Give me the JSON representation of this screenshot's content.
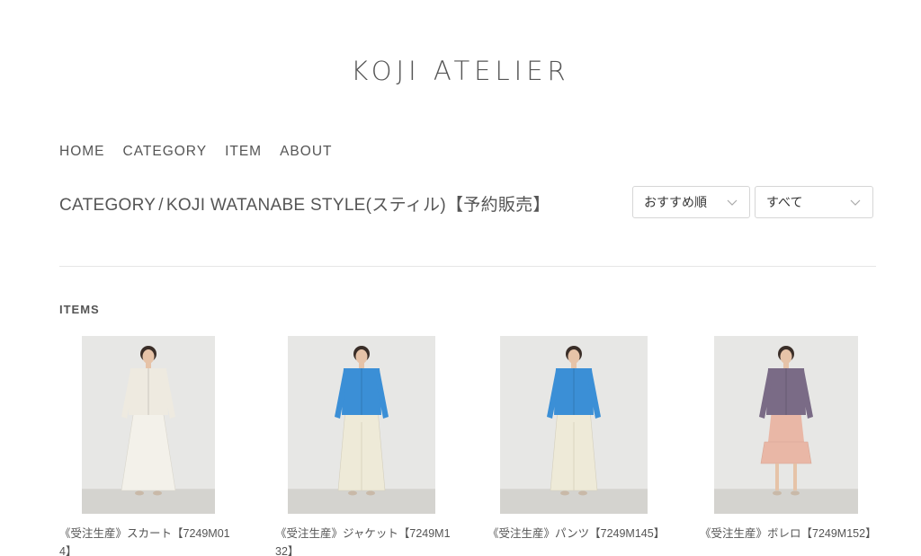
{
  "site": {
    "logo": "KOJI ATELIER"
  },
  "nav": {
    "items": [
      {
        "label": "HOME"
      },
      {
        "label": "CATEGORY"
      },
      {
        "label": "ITEM"
      },
      {
        "label": "ABOUT"
      }
    ]
  },
  "breadcrumb": {
    "section": "CATEGORY",
    "separator": "/",
    "current": "KOJI WATANABE STYLE(スティル)【予約販売】"
  },
  "sort": {
    "selected": "おすすめ順",
    "icon": "chevron-down-icon"
  },
  "filter": {
    "selected": "すべて",
    "icon": "chevron-down-icon"
  },
  "items_section": {
    "label": "ITEMS"
  },
  "products": [
    {
      "title": "《受注生産》スカート【7249M014】",
      "jacket_color": "#eeeae0",
      "bottom_color": "#f3f1ea",
      "bottom": "skirt"
    },
    {
      "title": "《受注生産》ジャケット【7249M132】",
      "jacket_color": "#3b8fd6",
      "bottom_color": "#eeead8",
      "bottom": "wide-pants"
    },
    {
      "title": "《受注生産》パンツ【7249M145】",
      "jacket_color": "#3b8fd6",
      "bottom_color": "#eeead8",
      "bottom": "wide-pants"
    },
    {
      "title": "《受注生産》ボレロ【7249M152】",
      "jacket_color": "#7a6b86",
      "bottom_color": "#e9b7a6",
      "bottom": "tiered-skirt"
    }
  ],
  "colors": {
    "text": "#555555",
    "border": "#d6d6d6",
    "photo_bg": "#e7e7e5"
  }
}
